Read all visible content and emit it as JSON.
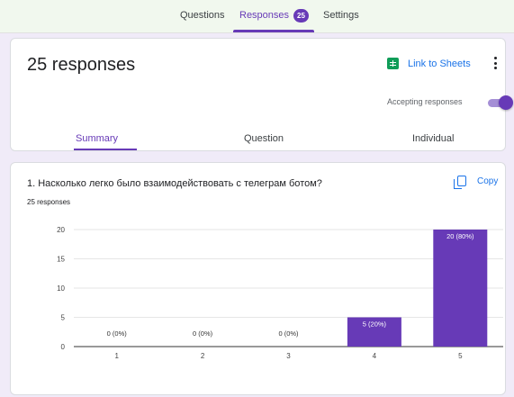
{
  "topnav": {
    "tabs": [
      {
        "label": "Questions"
      },
      {
        "label": "Responses"
      },
      {
        "label": "Settings"
      }
    ],
    "responses_badge": "25"
  },
  "summary_card": {
    "title": "25 responses",
    "link_to_sheets": "Link to Sheets",
    "accepting_label": "Accepting responses",
    "accepting_on": true,
    "subtabs": [
      {
        "label": "Summary"
      },
      {
        "label": "Question"
      },
      {
        "label": "Individual"
      }
    ]
  },
  "question_card": {
    "title": "1. Насколько легко было взаимодействовать с телеграм ботом?",
    "count": "25 responses",
    "copy_label": "Copy"
  },
  "colors": {
    "accent": "#673ab7",
    "link": "#1a73e8"
  },
  "chart_data": {
    "type": "bar",
    "categories": [
      "1",
      "2",
      "3",
      "4",
      "5"
    ],
    "values": [
      0,
      0,
      0,
      5,
      20
    ],
    "data_labels": [
      "0 (0%)",
      "0 (0%)",
      "0 (0%)",
      "5 (20%)",
      "20 (80%)"
    ],
    "yticks": [
      "0",
      "5",
      "10",
      "15",
      "20"
    ],
    "ylim": [
      0,
      20
    ],
    "grid": true,
    "bar_color": "#673ab7"
  }
}
